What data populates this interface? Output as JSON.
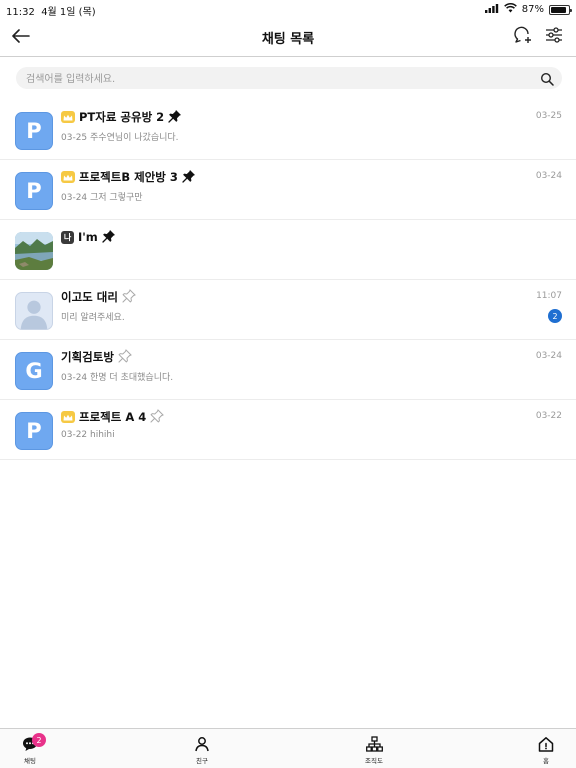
{
  "status_bar": {
    "time": "11:32",
    "date": "4월 1일 (목)",
    "battery": "87%",
    "battery_level": 0.87
  },
  "header": {
    "title": "채팅 목록",
    "back_icon": "back-arrow-icon",
    "new_chat_icon": "new-chat-icon",
    "settings_icon": "settings-icon"
  },
  "search": {
    "placeholder": "검색어를 입력하세요.",
    "value": ""
  },
  "chats": [
    {
      "name": "PT자료 공유방 2",
      "preview": "03-25 주수연님이 나갔습니다.",
      "time": "03-25",
      "avatar_letter": "P",
      "crown": true,
      "pinned": true
    },
    {
      "name": "프로젝트B 제안방 3",
      "preview": "03-24 그저 그렇구만",
      "time": "03-24",
      "avatar_letter": "P",
      "crown": true,
      "pinned": true
    },
    {
      "name": "I'm",
      "me_tag": "나",
      "preview": "",
      "time": "",
      "avatar": "landscape-photo",
      "pinned": true
    },
    {
      "name": "이고도 대리",
      "preview": "미리 알려주세요.",
      "time": "11:07",
      "avatar": "person-placeholder",
      "pinned": false,
      "unread": "2"
    },
    {
      "name": "기획검토방",
      "preview": "03-24 한명 더 초대했습니다.",
      "time": "03-24",
      "avatar_letter": "G",
      "pinned": false
    },
    {
      "name": "프로젝트 A 4",
      "preview": "03-22 hihihi",
      "time": "03-22",
      "avatar_letter": "P",
      "crown": true,
      "pinned": false
    }
  ],
  "tabbar": {
    "chat": {
      "label": "채팅",
      "badge": "2"
    },
    "friends": {
      "label": "친구"
    },
    "org": {
      "label": "조직도"
    },
    "home": {
      "label": "홈"
    }
  },
  "colors": {
    "avatar": "#6fa8f0",
    "crown": "#f6c944",
    "unread": "#1f6fd1",
    "tab_badge": "#e8328a"
  }
}
